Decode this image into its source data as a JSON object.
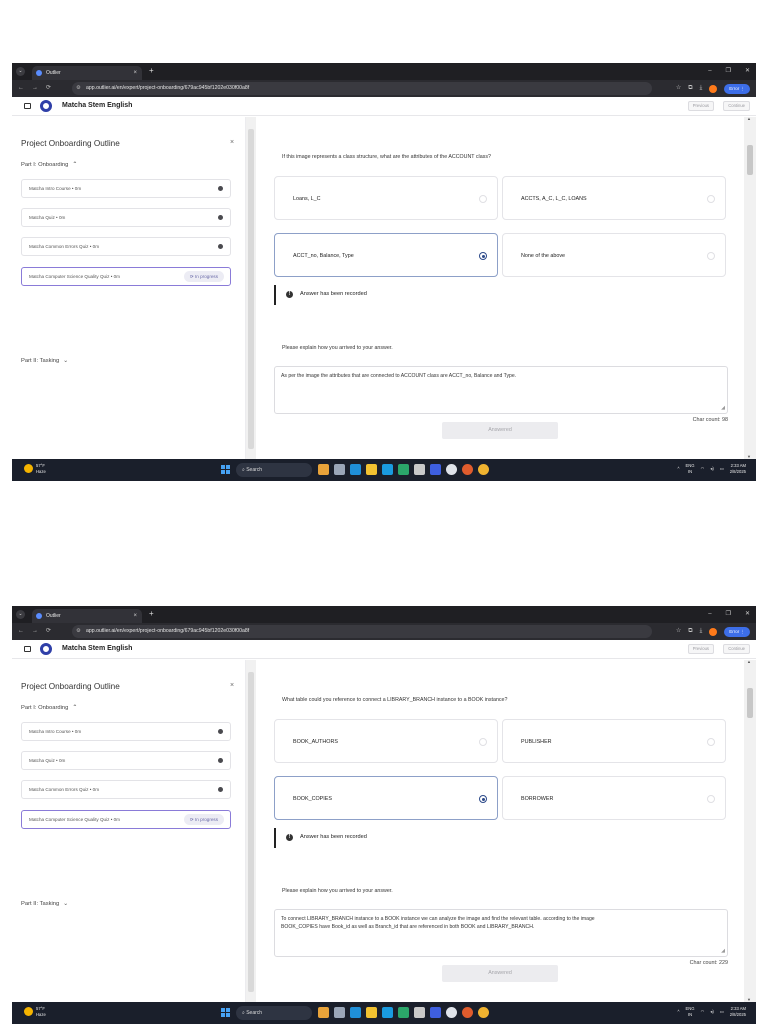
{
  "browser": {
    "tab_title": "Outlier",
    "url": "app.outlier.ai/en/expert/project-onboarding/679ac945bf1202e030f00a8f",
    "profile_label": "Error"
  },
  "app": {
    "title": "Matcha Stem English",
    "previous_label": "Previous",
    "continue_label": "Continue"
  },
  "sidebar": {
    "title": "Project Onboarding Outline",
    "close": "×",
    "part1": "Part I: Onboarding",
    "part2": "Part II: Tasking",
    "courses": [
      {
        "label": "Matcha Intro Course • 0m"
      },
      {
        "label": "Matcha Quiz • 0m"
      },
      {
        "label": "Matcha Common Errors Quiz • 0m"
      },
      {
        "label": "Matcha Computer Science Quality Quiz • 0m",
        "status": "In progress"
      }
    ]
  },
  "screens": [
    {
      "question": "If this image represents a class structure, what are the attributes of the ACCOUNT class?",
      "options": [
        "Loans, L_C",
        "ACCTS, A_C, L_C, LOANS",
        "ACCT_no, Balance, Type",
        "None of the above"
      ],
      "selected_index": 2,
      "recorded": "Answer has been recorded",
      "explain_prompt": "Please explain how you arrived to your answer.",
      "answer_lines": [
        "As per the image the attributes that are connected to ACCOUNT class are ACCT_no, Balance and Type."
      ],
      "char_count": "Char count: 98",
      "answered_label": "Answered"
    },
    {
      "question": "What table could you reference to connect a LIBRARY_BRANCH instance to a BOOK instance?",
      "options": [
        "BOOK_AUTHORS",
        "PUBLISHER",
        "BOOK_COPIES",
        "BORROWER"
      ],
      "selected_index": 2,
      "recorded": "Answer has been recorded",
      "explain_prompt": "Please explain how you arrived to your answer.",
      "answer_lines": [
        "To connect LIBRARY_BRANCH instance to a BOOK instance we can analyze the image and find the relevant table. according to the image",
        "BOOK_COPIES have Book_id as well as Branch_id that are referenced in both BOOK and LIBRARY_BRANCH."
      ],
      "char_count": "Char count: 229",
      "answered_label": "Answered"
    }
  ],
  "taskbar": {
    "weather_temp": "57°F",
    "weather_desc": "Haze",
    "search_placeholder": "Search",
    "lang_top": "ENG",
    "lang_bottom": "IN",
    "time": "2:33 AM",
    "date": "2/8/2025"
  },
  "colors": {
    "accent": "#2d4a8a",
    "selected_border": "#8da0c8",
    "progress_border": "#8a7bd8",
    "taskbar": "#1a1f2b",
    "browser_chrome": "#1f1f23"
  }
}
